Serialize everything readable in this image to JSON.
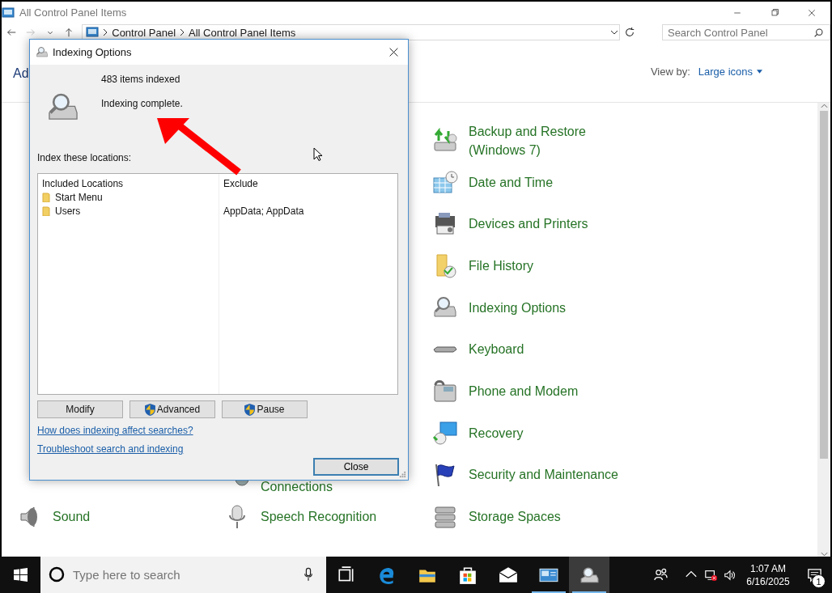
{
  "window": {
    "title": "All Control Panel Items"
  },
  "address_bar": {
    "breadcrumbs": [
      "Control Panel",
      "All Control Panel Items"
    ]
  },
  "search": {
    "placeholder": "Search Control Panel"
  },
  "header": {
    "title": "Ad",
    "view_by_label": "View by:",
    "view_by_value": "Large icons"
  },
  "columns": [
    {
      "items": [
        {
          "label": "Sound",
          "kind": "normal"
        }
      ]
    },
    {
      "items": [
        {
          "label": "Connections",
          "kind": "continuation"
        },
        {
          "label": "Speech Recognition",
          "kind": "normal"
        }
      ]
    },
    {
      "items": [
        {
          "label": "Backup and Restore (Windows 7)",
          "kind": "wrapped"
        },
        {
          "label": "Date and Time",
          "kind": "normal"
        },
        {
          "label": "Devices and Printers",
          "kind": "normal"
        },
        {
          "label": "File History",
          "kind": "normal"
        },
        {
          "label": "Indexing Options",
          "kind": "normal"
        },
        {
          "label": "Keyboard",
          "kind": "normal"
        },
        {
          "label": "Phone and Modem",
          "kind": "normal"
        },
        {
          "label": "Recovery",
          "kind": "normal"
        },
        {
          "label": "Security and Maintenance",
          "kind": "normal"
        },
        {
          "label": "Storage Spaces",
          "kind": "normal"
        }
      ]
    }
  ],
  "dialog": {
    "title": "Indexing Options",
    "count": "483 items indexed",
    "status": "Indexing complete.",
    "locations_label": "Index these locations:",
    "table": {
      "columns": [
        "Included Locations",
        "Exclude"
      ],
      "rows": [
        {
          "location": "Start Menu"
        },
        {
          "location": "Users",
          "exclude": "AppData; AppData"
        }
      ]
    },
    "buttons": [
      {
        "label": "Modify",
        "shield": false
      },
      {
        "label": "Advanced",
        "shield": true
      },
      {
        "label": "Pause",
        "shield": true
      }
    ],
    "links": [
      "How does indexing affect searches?",
      "Troubleshoot search and indexing"
    ],
    "close_button": {
      "label": "Close",
      "default": true
    }
  },
  "taskbar": {
    "search_placeholder": "Type here to search",
    "apps": [
      {
        "kind": "task-view",
        "running": false,
        "selected": false
      },
      {
        "kind": "edge",
        "running": false,
        "selected": false
      },
      {
        "kind": "explorer",
        "running": false,
        "selected": false
      },
      {
        "kind": "store",
        "running": false,
        "selected": false
      },
      {
        "kind": "mail",
        "running": false,
        "selected": false
      },
      {
        "kind": "control-panel",
        "running": true,
        "selected": false
      },
      {
        "kind": "indexing",
        "running": true,
        "selected": true
      }
    ],
    "time": "1:07 AM",
    "date": "6/16/2025",
    "notification_count": "1"
  }
}
